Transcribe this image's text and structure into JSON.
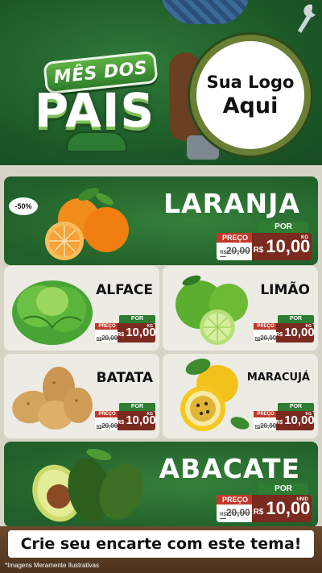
{
  "header": {
    "title_top": "MÊS DOS",
    "title_main": "PAIS",
    "logo_line1": "Sua Logo",
    "logo_line2": "Aqui"
  },
  "products": [
    {
      "name": "LARANJA",
      "discount": "-50%",
      "price_label": "PREÇO",
      "por_label": "POR",
      "old_price": "20,00",
      "old_currency": "R$",
      "currency": "R$",
      "price": "10,00",
      "unit": "KG"
    },
    {
      "name": "ALFACE",
      "price_label": "PREÇO",
      "por_label": "POR",
      "old_price": "20,00",
      "old_currency": "R$",
      "currency": "R$",
      "price": "10,00",
      "unit": "KG"
    },
    {
      "name": "LIMÃO",
      "price_label": "PREÇO",
      "por_label": "POR",
      "old_price": "20,00",
      "old_currency": "R$",
      "currency": "R$",
      "price": "10,00",
      "unit": "KG"
    },
    {
      "name": "BATATA",
      "price_label": "PREÇO",
      "por_label": "POR",
      "old_price": "20,00",
      "old_currency": "R$",
      "currency": "R$",
      "price": "10,00",
      "unit": "KG"
    },
    {
      "name": "MARACUJÁ",
      "price_label": "PREÇO",
      "por_label": "POR",
      "old_price": "20,00",
      "old_currency": "R$",
      "currency": "R$",
      "price": "10,00",
      "unit": "KG"
    },
    {
      "name": "ABACATE",
      "price_label": "PREÇO",
      "por_label": "POR",
      "old_price": "20,00",
      "old_currency": "R$",
      "currency": "R$",
      "price": "10,00",
      "unit": "UNID"
    }
  ],
  "footer": {
    "cta": "Crie seu encarte com este tema!",
    "disclaimer": "*Imagens Meramente Ilustrativas"
  },
  "colors": {
    "brand_green": "#21602a",
    "price_red": "#c0392b",
    "price_dark": "#7a2a1f"
  }
}
